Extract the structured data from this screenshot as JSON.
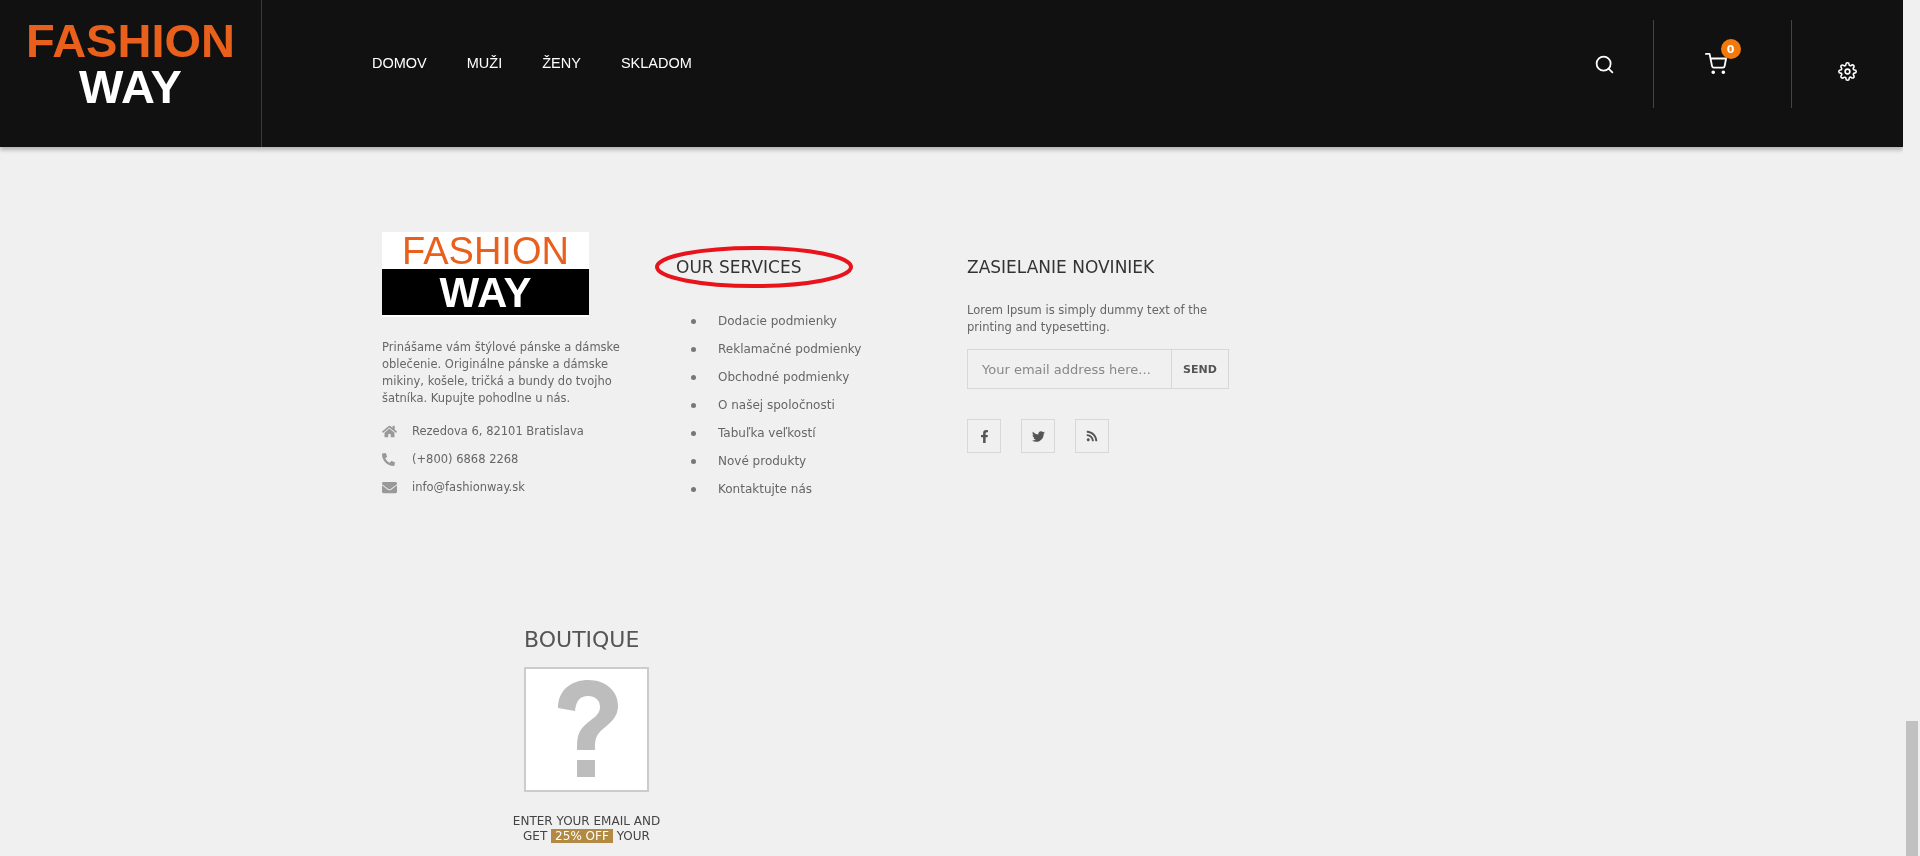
{
  "header": {
    "logo": {
      "line1": "FASHION",
      "line2": "WAY"
    },
    "nav": [
      {
        "label": "DOMOV"
      },
      {
        "label": "MUŽI"
      },
      {
        "label": "ŽENY"
      },
      {
        "label": "SKLADOM"
      }
    ],
    "cart_count": "0"
  },
  "footer": {
    "about": {
      "logo": {
        "line1": "FASHION",
        "line2": "WAY"
      },
      "description": "Prinášame vám štýlové pánske a dámske oblečenie. Originálne pánske a dámske mikiny, košele, tričká a bundy do tvojho šatníka. Kupujte pohodlne u nás.",
      "contacts": [
        {
          "kind": "address",
          "text": "Rezedova 6, 82101 Bratislava"
        },
        {
          "kind": "phone",
          "text": "(+800) 6868 2268"
        },
        {
          "kind": "email",
          "text": "info@fashionway.sk"
        }
      ]
    },
    "services": {
      "title": "OUR SERVICES",
      "highlighted": true,
      "links": [
        "Dodacie podmienky",
        "Reklamačné podmienky",
        "Obchodné podmienky",
        "O našej spoločnosti",
        "Tabuľka veľkostí",
        "Nové produkty",
        "Kontaktujte nás"
      ]
    },
    "newsletter": {
      "title": "ZASIELANIE NOVINIEK",
      "text": "Lorem Ipsum is simply dummy text of the printing and typesetting.",
      "placeholder": "Your email address here...",
      "button": "SEND",
      "social": [
        {
          "kind": "facebook"
        },
        {
          "kind": "twitter"
        },
        {
          "kind": "rss"
        }
      ]
    }
  },
  "boutique": {
    "title": "BOUTIQUE",
    "promo_line1": "ENTER YOUR EMAIL AND",
    "promo_line2": {
      "before": "GET",
      "highlight": "25% OFF",
      "after": "YOUR"
    }
  }
}
